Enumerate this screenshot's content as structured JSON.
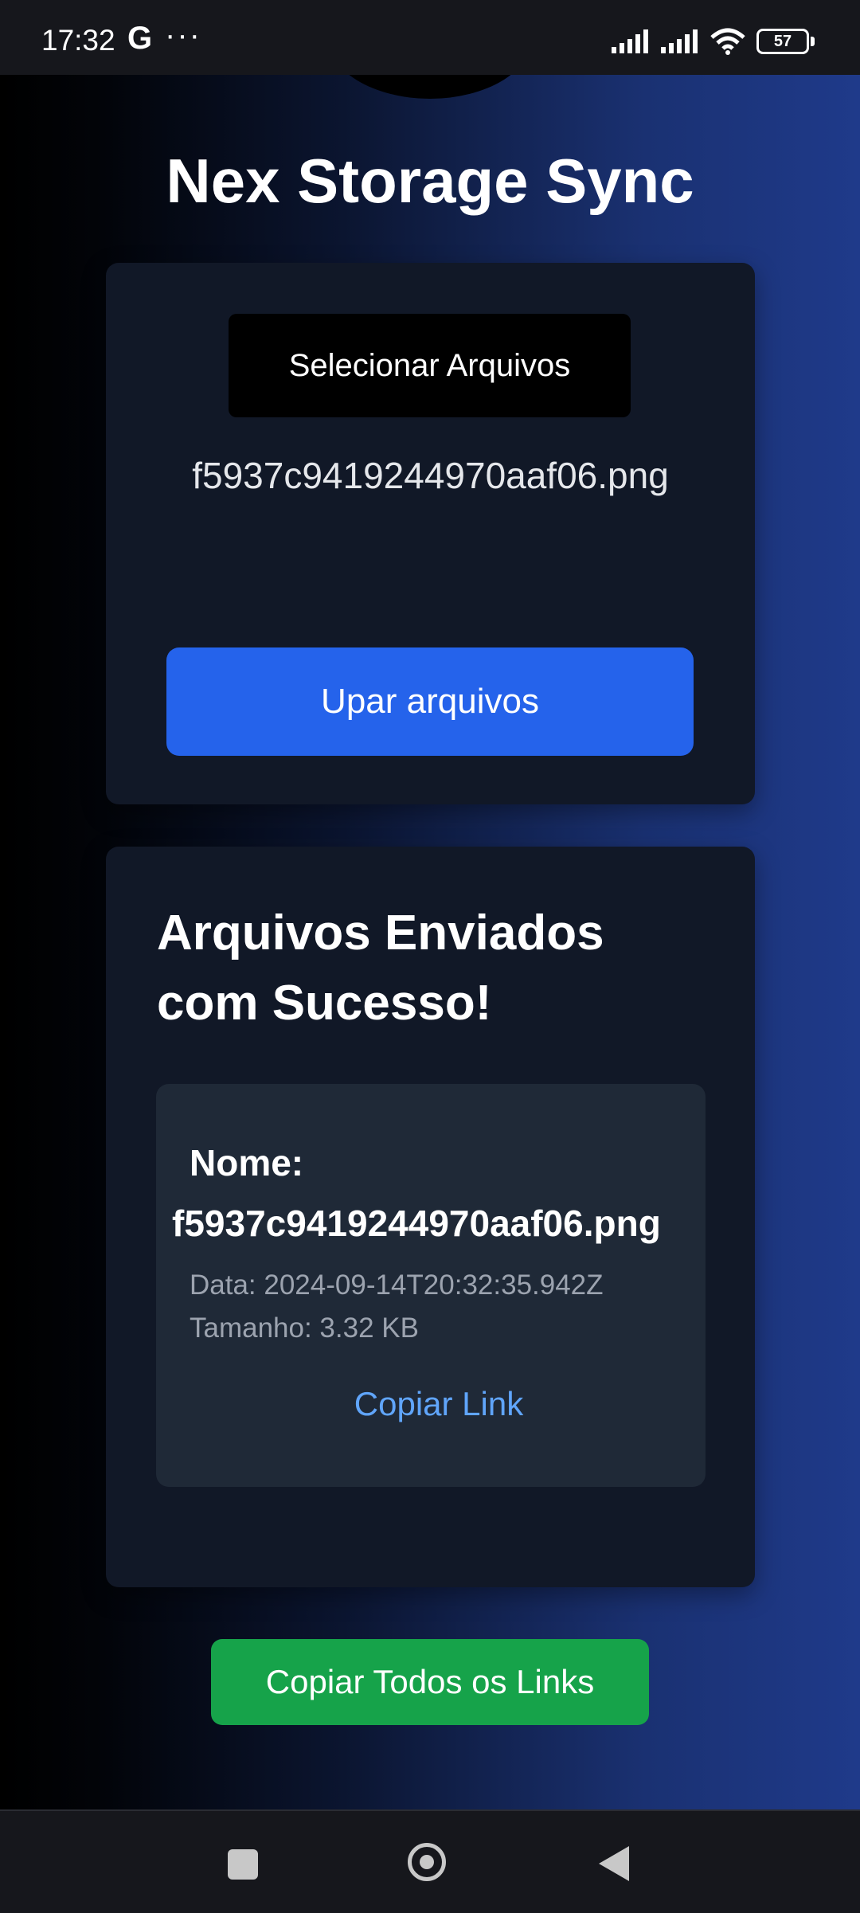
{
  "status_bar": {
    "time": "17:32",
    "g_glyph": "G",
    "dots": "···",
    "battery_level": "57",
    "icons": [
      "signal-icon",
      "signal-icon",
      "wifi-icon",
      "battery-icon"
    ]
  },
  "app": {
    "title": "Nex Storage Sync"
  },
  "upload": {
    "select_label": "Selecionar Arquivos",
    "selected_file": "f5937c9419244970aaf06.png",
    "upload_label": "Upar arquivos"
  },
  "results": {
    "title": "Arquivos Enviados com Sucesso!",
    "files": [
      {
        "name_label": "Nome:",
        "name": "f5937c9419244970aaf06.png",
        "date": "Data: 2024-09-14T20:32:35.942Z",
        "size": "Tamanho: 3.32 KB",
        "copy_label": "Copiar Link"
      }
    ]
  },
  "copy_all_label": "Copiar Todos os Links",
  "nav_bar": {
    "icons": [
      "recents-icon",
      "home-icon",
      "back-icon"
    ]
  },
  "colors": {
    "primary": "#2563eb",
    "success": "#16a34a",
    "link": "#60a5fa",
    "card": "#111827",
    "card_inner": "#1f2937"
  }
}
